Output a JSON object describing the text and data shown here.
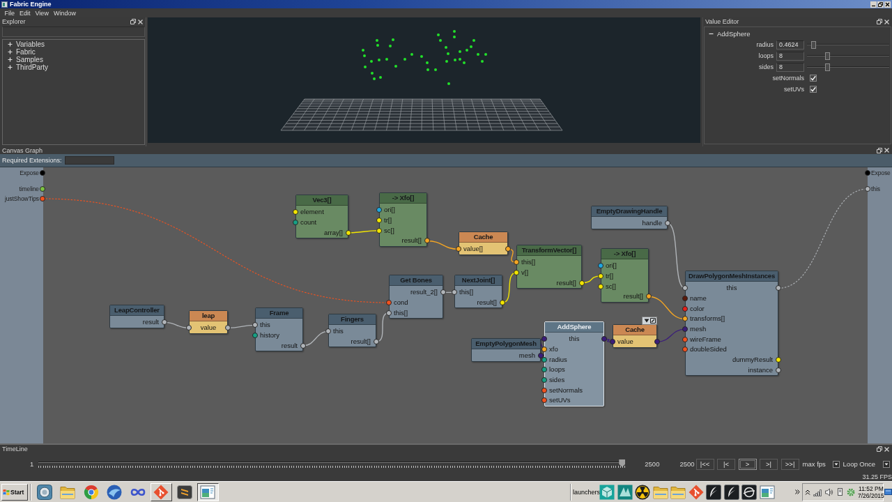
{
  "window": {
    "title": "Fabric Engine"
  },
  "menu": [
    "File",
    "Edit",
    "View",
    "Window"
  ],
  "explorer": {
    "title": "Explorer",
    "items": [
      {
        "label": "Variables",
        "expanded": false
      },
      {
        "label": "Fabric",
        "expanded": false
      },
      {
        "label": "Samples",
        "expanded": false
      },
      {
        "label": "ThirdParty",
        "expanded": false
      }
    ]
  },
  "value_editor": {
    "title": "Value Editor",
    "group": {
      "label": "AddSphere",
      "expanded": true,
      "fields": [
        {
          "kind": "number",
          "label": "radius",
          "value": "0.4624",
          "level": 0.05
        },
        {
          "kind": "number",
          "label": "loops",
          "value": "8",
          "level": 0.23
        },
        {
          "kind": "number",
          "label": "sides",
          "value": "8",
          "level": 0.23
        },
        {
          "kind": "checkbox",
          "label": "setNormals",
          "checked": true
        },
        {
          "kind": "checkbox",
          "label": "setUVs",
          "checked": true
        }
      ]
    }
  },
  "canvas_graph": {
    "title": "Canvas Graph",
    "required_extensions": {
      "label": "Required Extensions:"
    },
    "left_ports": [
      {
        "label": "Expose",
        "color": "#000000"
      },
      {
        "label": "timeline",
        "color": "#7cc242"
      },
      {
        "label": "justShowTips",
        "color": "#f2521f"
      }
    ],
    "right_ports": [
      {
        "label": "Expose",
        "color": "#000000"
      },
      {
        "label": "this",
        "color": "#b0b4b8"
      }
    ],
    "nodes": [
      {
        "title": "Vec3[]",
        "kind": "preset",
        "selected": false,
        "hovered": false,
        "ports": [
          {
            "label": "element",
            "kind": "in",
            "color": "#f2e500"
          },
          {
            "label": "count",
            "kind": "in",
            "color": "#16a084"
          },
          {
            "label": "array[]",
            "kind": "out",
            "color": "#f2e500"
          }
        ]
      },
      {
        "title": "-> Xfo[]",
        "kind": "preset",
        "selected": false,
        "hovered": false,
        "ports": [
          {
            "label": "ori[]",
            "kind": "in",
            "color": "#1fa8e0"
          },
          {
            "label": "tr[]",
            "kind": "in",
            "color": "#f2e500"
          },
          {
            "label": "sc[]",
            "kind": "in",
            "color": "#f2e500"
          },
          {
            "label": "result[]",
            "kind": "out",
            "color": "#f5a623"
          }
        ]
      },
      {
        "title": "EmptyDrawingHandle",
        "kind": "function",
        "selected": false,
        "hovered": false,
        "ports": [
          {
            "label": "handle",
            "kind": "out",
            "color": "#b0b4b8"
          }
        ]
      },
      {
        "title": "Cache",
        "kind": "cache",
        "selected": false,
        "hovered": false,
        "ports": [
          {
            "label": "value[]",
            "kind": "io",
            "color": "#f5a623"
          }
        ]
      },
      {
        "title": "TransformVector[]",
        "kind": "preset",
        "selected": false,
        "hovered": false,
        "ports": [
          {
            "label": "this[]",
            "kind": "in",
            "color": "#f5a623"
          },
          {
            "label": "v[]",
            "kind": "in",
            "color": "#f2e500"
          },
          {
            "label": "result[]",
            "kind": "out",
            "color": "#f2e500"
          }
        ]
      },
      {
        "title": "-> Xfo[]",
        "kind": "preset",
        "selected": false,
        "hovered": false,
        "ports": [
          {
            "label": "ori[]",
            "kind": "in",
            "color": "#1fa8e0"
          },
          {
            "label": "tr[]",
            "kind": "in",
            "color": "#f2e500"
          },
          {
            "label": "sc[]",
            "kind": "in",
            "color": "#f2e500"
          },
          {
            "label": "result[]",
            "kind": "out",
            "color": "#f5a623"
          }
        ]
      },
      {
        "title": "Get Bones",
        "kind": "function",
        "selected": false,
        "hovered": false,
        "ports": [
          {
            "label": "result_2[]",
            "kind": "out",
            "color": "#b0b4b8"
          },
          {
            "label": "cond",
            "kind": "in",
            "color": "#f2521f"
          },
          {
            "label": "this[]",
            "kind": "in",
            "color": "#b0b4b8"
          }
        ]
      },
      {
        "title": "NextJoint[]",
        "kind": "function",
        "selected": false,
        "hovered": false,
        "ports": [
          {
            "label": "this[]",
            "kind": "in",
            "color": "#b0b4b8"
          },
          {
            "label": "result[]",
            "kind": "out",
            "color": "#f2e500"
          }
        ]
      },
      {
        "title": "DrawPolygonMeshInstances",
        "kind": "function",
        "selected": false,
        "hovered": false,
        "ports": [
          {
            "label": "this",
            "kind": "io",
            "color": "#b0b4b8"
          },
          {
            "label": "name",
            "kind": "in",
            "color": "#5a1a0c"
          },
          {
            "label": "color",
            "kind": "in",
            "color": "#e8201a"
          },
          {
            "label": "transforms[]",
            "kind": "in",
            "color": "#f5a623"
          },
          {
            "label": "mesh",
            "kind": "in",
            "color": "#3b1d7a"
          },
          {
            "label": "wireFrame",
            "kind": "in",
            "color": "#f2521f"
          },
          {
            "label": "doubleSided",
            "kind": "in",
            "color": "#f2521f"
          },
          {
            "label": "dummyResult",
            "kind": "out",
            "color": "#f2e500"
          },
          {
            "label": "instance",
            "kind": "out",
            "color": "#b0b4b8"
          }
        ]
      },
      {
        "title": "LeapController",
        "kind": "function",
        "selected": false,
        "hovered": false,
        "ports": [
          {
            "label": "result",
            "kind": "out",
            "color": "#b0b4b8"
          }
        ]
      },
      {
        "title": "leap",
        "kind": "variable",
        "selected": false,
        "hovered": false,
        "ports": [
          {
            "label": "value",
            "kind": "io",
            "color": "#b0b4b8"
          }
        ]
      },
      {
        "title": "Frame",
        "kind": "function",
        "selected": false,
        "hovered": false,
        "ports": [
          {
            "label": "this",
            "kind": "in",
            "color": "#b0b4b8"
          },
          {
            "label": "history",
            "kind": "in",
            "color": "#16a084"
          },
          {
            "label": "result",
            "kind": "out",
            "color": "#b0b4b8"
          }
        ]
      },
      {
        "title": "Fingers",
        "kind": "function",
        "selected": false,
        "hovered": false,
        "ports": [
          {
            "label": "this",
            "kind": "in",
            "color": "#b0b4b8"
          },
          {
            "label": "result[]",
            "kind": "out",
            "color": "#b0b4b8"
          }
        ]
      },
      {
        "title": "AddSphere",
        "kind": "function",
        "selected": true,
        "hovered": false,
        "ports": [
          {
            "label": "this",
            "kind": "io",
            "color": "#3b1d7a"
          },
          {
            "label": "xfo",
            "kind": "in",
            "color": "#f5a623"
          },
          {
            "label": "radius",
            "kind": "in",
            "color": "#16a084"
          },
          {
            "label": "loops",
            "kind": "in",
            "color": "#16a084"
          },
          {
            "label": "sides",
            "kind": "in",
            "color": "#16a084"
          },
          {
            "label": "setNormals",
            "kind": "in",
            "color": "#f2521f"
          },
          {
            "label": "setUVs",
            "kind": "in",
            "color": "#f2521f"
          }
        ]
      },
      {
        "title": "Cache",
        "kind": "cache",
        "selected": false,
        "hovered": true,
        "ports": [
          {
            "label": "value",
            "kind": "io",
            "color": "#3b1d7a"
          }
        ]
      },
      {
        "title": "EmptyPolygonMesh",
        "kind": "function",
        "selected": false,
        "hovered": false,
        "ports": [
          {
            "label": "mesh",
            "kind": "out",
            "color": "#3b1d7a"
          }
        ]
      }
    ]
  },
  "timeline": {
    "title": "TimeLine",
    "start": "1",
    "level": 1,
    "end": "2500",
    "frame": "2500",
    "buttons": [
      {
        "label": "|<<",
        "focused": false
      },
      {
        "label": "|<",
        "focused": false
      },
      {
        "label": ">",
        "focused": true
      },
      {
        "label": ">|",
        "focused": false
      },
      {
        "label": ">>|",
        "focused": false
      }
    ],
    "rate": "max fps",
    "loop": "Loop Once",
    "fps": "31.25 FPS"
  },
  "taskbar": {
    "start": "Start",
    "quick_launch": [
      {
        "kind": "dial",
        "running": false,
        "selected": false
      },
      {
        "kind": "folder",
        "running": false,
        "selected": false
      },
      {
        "kind": "browser",
        "running": false,
        "selected": false
      },
      {
        "kind": "mail",
        "running": false,
        "selected": false
      },
      {
        "kind": "infinity",
        "running": false,
        "selected": false
      },
      {
        "kind": "git",
        "running": true,
        "selected": false
      },
      {
        "kind": "editor",
        "running": false,
        "selected": false
      },
      {
        "kind": "window",
        "running": true,
        "selected": true
      }
    ],
    "launchers_label": "launchers",
    "launchers": [
      {
        "kind": "cube"
      },
      {
        "kind": "prism"
      },
      {
        "kind": "radiation"
      },
      {
        "kind": "folder"
      },
      {
        "kind": "folder"
      },
      {
        "kind": "git"
      },
      {
        "kind": "feather"
      },
      {
        "kind": "feather"
      },
      {
        "kind": "swirl"
      },
      {
        "kind": "window"
      }
    ],
    "clock": {
      "time": "11:52 PM",
      "date": "7/26/2015"
    }
  }
}
